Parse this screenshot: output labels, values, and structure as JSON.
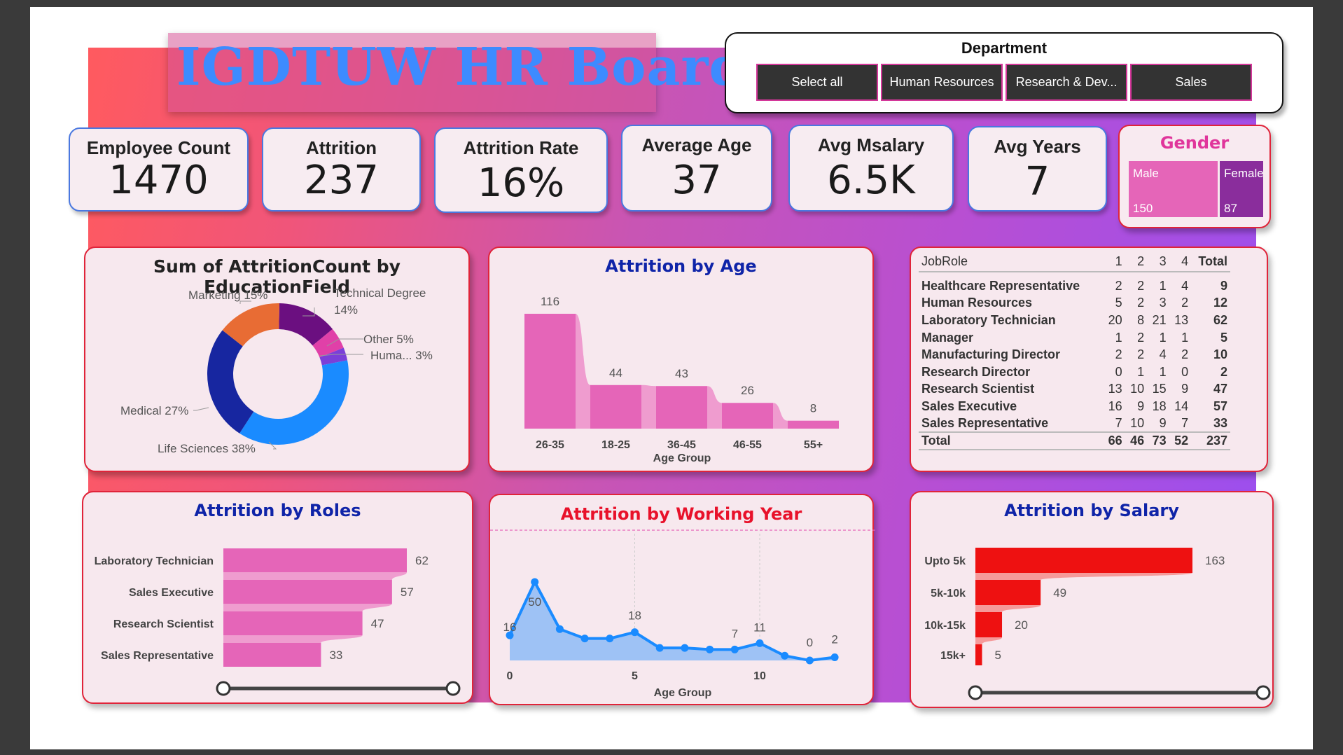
{
  "title": "IGDTUW HR Board",
  "department": {
    "title": "Department",
    "options": [
      "Select all",
      "Human Resources",
      "Research & Dev...",
      "Sales"
    ]
  },
  "kpis": [
    {
      "label": "Employee Count",
      "value": "1470"
    },
    {
      "label": "Attrition",
      "value": "237"
    },
    {
      "label": "Attrition Rate",
      "value": "16%"
    },
    {
      "label": "Average Age",
      "value": "37"
    },
    {
      "label": "Avg Msalary",
      "value": "6.5K"
    },
    {
      "label": "Avg Years",
      "value": "7"
    }
  ],
  "gender": {
    "title": "Gender",
    "male_label": "Male",
    "male_value": "150",
    "female_label": "Female",
    "female_value": "87"
  },
  "colors": {
    "pink": "#e565b8",
    "purple": "#8a2d9c",
    "blue": "#1a8bff",
    "red": "#ee1111",
    "navy": "#0f24a8"
  },
  "charts": {
    "education": {
      "title": "Sum of AttritionCount by EducationField",
      "labels": [
        "Technical Degree",
        "14%",
        "Other 5%",
        "Huma... 3%",
        "Life Sciences 38%",
        "Medical 27%",
        "Marketing 15%"
      ]
    },
    "age": {
      "title": "Attrition by Age",
      "xlabel": "Age Group"
    },
    "roles": {
      "title": "Attrition by Roles"
    },
    "working_year": {
      "title": "Attrition by Working Year",
      "xlabel": "Age Group"
    },
    "salary": {
      "title": "Attrition by Salary"
    }
  },
  "chart_data": [
    {
      "type": "pie",
      "title": "Sum of AttritionCount by EducationField",
      "categories": [
        "Life Sciences",
        "Medical",
        "Marketing",
        "Technical Degree",
        "Other",
        "Human Resources"
      ],
      "values": [
        38,
        27,
        15,
        14,
        5,
        3
      ],
      "colors": [
        "#1a8bff",
        "#1726a0",
        "#e86c34",
        "#6b0f80",
        "#e040a8",
        "#7b3fd8"
      ]
    },
    {
      "type": "bar",
      "title": "Attrition by Age",
      "xlabel": "Age Group",
      "categories": [
        "26-35",
        "18-25",
        "36-45",
        "46-55",
        "55+"
      ],
      "values": [
        116,
        44,
        43,
        26,
        8
      ]
    },
    {
      "type": "bar",
      "title": "Attrition by Roles",
      "categories": [
        "Laboratory Technician",
        "Sales Executive",
        "Research Scientist",
        "Sales Representative"
      ],
      "values": [
        62,
        57,
        47,
        33
      ]
    },
    {
      "type": "area",
      "title": "Attrition by Working Year",
      "xlabel": "Age Group",
      "x": [
        0,
        1,
        2,
        3,
        4,
        5,
        6,
        7,
        8,
        9,
        10,
        11,
        12,
        13
      ],
      "values": [
        16,
        50,
        20,
        14,
        14,
        18,
        8,
        8,
        7,
        7,
        11,
        3,
        0,
        2
      ],
      "shown_labels": {
        "0": "16",
        "1": "50",
        "5": "18",
        "9": "7",
        "10": "11",
        "12": "0",
        "13": "2"
      },
      "xticks": [
        "0",
        "5",
        "10"
      ]
    },
    {
      "type": "bar",
      "title": "Attrition by Salary",
      "categories": [
        "Upto 5k",
        "5k-10k",
        "10k-15k",
        "15k+"
      ],
      "values": [
        163,
        49,
        20,
        5
      ]
    },
    {
      "type": "table",
      "columns": [
        "JobRole",
        "1",
        "2",
        "3",
        "4",
        "Total"
      ],
      "rows": [
        [
          "Healthcare Representative",
          "2",
          "2",
          "1",
          "4",
          "9"
        ],
        [
          "Human Resources",
          "5",
          "2",
          "3",
          "2",
          "12"
        ],
        [
          "Laboratory Technician",
          "20",
          "8",
          "21",
          "13",
          "62"
        ],
        [
          "Manager",
          "1",
          "2",
          "1",
          "1",
          "5"
        ],
        [
          "Manufacturing Director",
          "2",
          "2",
          "4",
          "2",
          "10"
        ],
        [
          "Research Director",
          "0",
          "1",
          "1",
          "0",
          "2"
        ],
        [
          "Research Scientist",
          "13",
          "10",
          "15",
          "9",
          "47"
        ],
        [
          "Sales Executive",
          "16",
          "9",
          "18",
          "14",
          "57"
        ],
        [
          "Sales Representative",
          "7",
          "10",
          "9",
          "7",
          "33"
        ]
      ],
      "total": [
        "Total",
        "66",
        "46",
        "73",
        "52",
        "237"
      ]
    }
  ]
}
